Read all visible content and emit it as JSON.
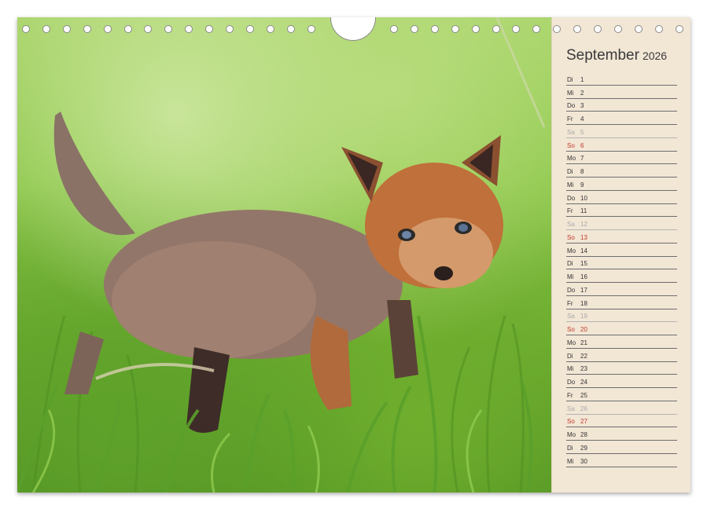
{
  "calendar": {
    "month": "September",
    "year": "2026",
    "days": [
      {
        "wd": "Di",
        "d": "1",
        "type": "weekday"
      },
      {
        "wd": "Mi",
        "d": "2",
        "type": "weekday"
      },
      {
        "wd": "Do",
        "d": "3",
        "type": "weekday"
      },
      {
        "wd": "Fr",
        "d": "4",
        "type": "weekday"
      },
      {
        "wd": "Sa",
        "d": "5",
        "type": "sat"
      },
      {
        "wd": "So",
        "d": "6",
        "type": "sun"
      },
      {
        "wd": "Mo",
        "d": "7",
        "type": "weekday"
      },
      {
        "wd": "Di",
        "d": "8",
        "type": "weekday"
      },
      {
        "wd": "Mi",
        "d": "9",
        "type": "weekday"
      },
      {
        "wd": "Do",
        "d": "10",
        "type": "weekday"
      },
      {
        "wd": "Fr",
        "d": "11",
        "type": "weekday"
      },
      {
        "wd": "Sa",
        "d": "12",
        "type": "sat"
      },
      {
        "wd": "So",
        "d": "13",
        "type": "sun"
      },
      {
        "wd": "Mo",
        "d": "14",
        "type": "weekday"
      },
      {
        "wd": "Di",
        "d": "15",
        "type": "weekday"
      },
      {
        "wd": "Mi",
        "d": "16",
        "type": "weekday"
      },
      {
        "wd": "Do",
        "d": "17",
        "type": "weekday"
      },
      {
        "wd": "Fr",
        "d": "18",
        "type": "weekday"
      },
      {
        "wd": "Sa",
        "d": "19",
        "type": "sat"
      },
      {
        "wd": "So",
        "d": "20",
        "type": "sun"
      },
      {
        "wd": "Mo",
        "d": "21",
        "type": "weekday"
      },
      {
        "wd": "Di",
        "d": "22",
        "type": "weekday"
      },
      {
        "wd": "Mi",
        "d": "23",
        "type": "weekday"
      },
      {
        "wd": "Do",
        "d": "24",
        "type": "weekday"
      },
      {
        "wd": "Fr",
        "d": "25",
        "type": "weekday"
      },
      {
        "wd": "Sa",
        "d": "26",
        "type": "sat"
      },
      {
        "wd": "So",
        "d": "27",
        "type": "sun"
      },
      {
        "wd": "Mo",
        "d": "28",
        "type": "weekday"
      },
      {
        "wd": "Di",
        "d": "29",
        "type": "weekday"
      },
      {
        "wd": "Mi",
        "d": "30",
        "type": "weekday"
      }
    ]
  },
  "photo": {
    "subject": "fox-cub-in-grass"
  },
  "colors": {
    "sidebar": "#f2e6d5",
    "sunday": "#c0392b",
    "saturday": "#a9a9a9",
    "text": "#333333"
  }
}
